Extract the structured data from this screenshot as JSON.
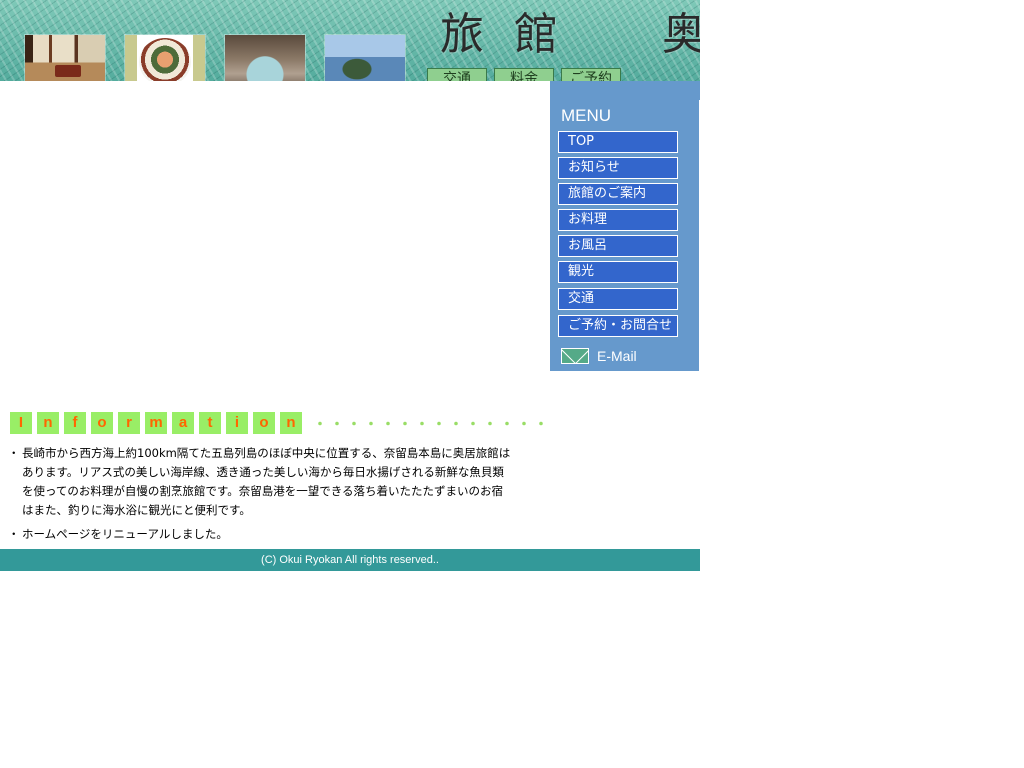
{
  "header": {
    "site_title": "旅館　奥居",
    "photos": [
      "room-photo",
      "dish-photo",
      "bath-photo",
      "sea-photo"
    ],
    "nav_buttons": {
      "access": "交通",
      "price": "料金",
      "reserve": "ご予約"
    }
  },
  "sidebar": {
    "menu_title": "MENU",
    "items": [
      {
        "label": "TOP"
      },
      {
        "label": "お知らせ"
      },
      {
        "label": "旅館のご案内"
      },
      {
        "label": "お料理"
      },
      {
        "label": "お風呂"
      },
      {
        "label": "観光"
      },
      {
        "label": "交通"
      },
      {
        "label": "ご予約・お問合せ"
      }
    ],
    "email": {
      "label": "E-Mail",
      "icon": "mail-icon"
    }
  },
  "info": {
    "heading_letters": [
      "I",
      "n",
      "f",
      "o",
      "r",
      "m",
      "a",
      "t",
      "i",
      "o",
      "n"
    ],
    "heading_dots": "・・・・・・・・・・・・・・",
    "bullet": "・",
    "items": [
      {
        "lines": [
          "長崎市から西方海上約100km隔てた五島列島のほぼ中央に位置する、奈留島本島に奥居旅館は",
          "あります。リアス式の美しい海岸線、透き通った美しい海から毎日水揚げされる新鮮な魚貝類",
          "を使ってのお料理が自慢の割烹旅館です。奈留島港を一望できる落ち着いたたたずまいのお宿",
          "はまた、釣りに海水浴に観光にと便利です。"
        ]
      },
      {
        "lines": [
          "ホームページをリニューアルしました。"
        ]
      }
    ]
  },
  "footer": {
    "copyright": "(C) Okui Ryokan All rights reserved.."
  },
  "colors": {
    "header_teal": "#4aa597",
    "sidebar_blue": "#6699cc",
    "menu_button": "#3366cc",
    "footer_teal": "#339999",
    "info_letter_bg": "#99ee66",
    "info_letter_fg": "#ff6600",
    "nav_button_bg": "#8fcf8f"
  }
}
